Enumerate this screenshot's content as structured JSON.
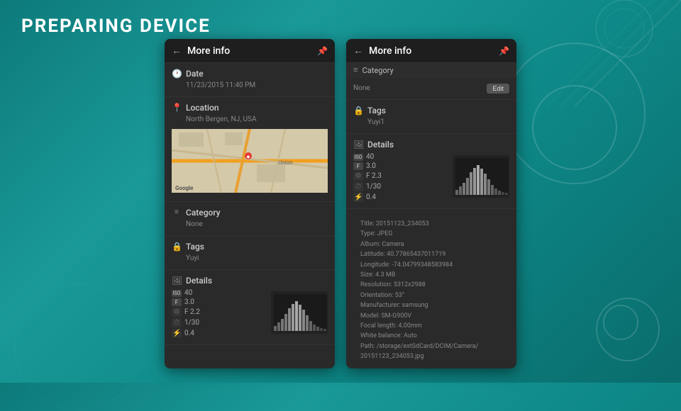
{
  "page": {
    "title": "PREPARING DEVICE",
    "background_color": "#0d8080"
  },
  "left_panel": {
    "header": {
      "back_label": "←",
      "title": "More info",
      "pin_icon": "📌"
    },
    "date_section": {
      "label": "Date",
      "icon": "🕐",
      "value": "11/23/2015 11:40 PM"
    },
    "location_section": {
      "label": "Location",
      "icon": "📍",
      "value": "North Bergen, NJ, USA"
    },
    "category_section": {
      "label": "Category",
      "icon": "≡",
      "value": "None"
    },
    "tags_section": {
      "label": "Tags",
      "icon": "🔒",
      "value": "Yuyi"
    },
    "details_section": {
      "label": "Details",
      "icon": "🖼",
      "rows": [
        {
          "icon": "ISO",
          "value": "40"
        },
        {
          "icon": "F",
          "value": "3.0"
        },
        {
          "icon": "⚙",
          "value": "F 2.2"
        },
        {
          "icon": "⏱",
          "value": "1/30"
        },
        {
          "icon": "⚡",
          "value": "0.4"
        }
      ]
    }
  },
  "right_panel": {
    "header": {
      "back_label": "←",
      "title": "More info",
      "pin_icon": "📌"
    },
    "category_section": {
      "label": "Category",
      "icon": "≡",
      "value": "None",
      "edit_label": "Edit"
    },
    "tags_section": {
      "label": "Tags",
      "icon": "🔒",
      "value": "Yuyi1"
    },
    "details_section": {
      "label": "Details",
      "icon": "🖼",
      "rows": [
        {
          "icon": "ISO",
          "value": "40"
        },
        {
          "icon": "F",
          "value": "3.0"
        },
        {
          "icon": "⚙",
          "value": "F 2.3"
        },
        {
          "icon": "⏱",
          "value": "1/30"
        },
        {
          "icon": "⚡",
          "value": "0.4"
        }
      ]
    },
    "meta": [
      {
        "label": "Title",
        "value": "20151123_234053"
      },
      {
        "label": "Type",
        "value": "JPEG"
      },
      {
        "label": "Album",
        "value": "Camera"
      },
      {
        "label": "Latitude",
        "value": "40.77865437011719"
      },
      {
        "label": "Longitude",
        "value": "-74.04799348583984"
      },
      {
        "label": "Size",
        "value": "4.3 MB"
      },
      {
        "label": "Resolution",
        "value": "5312x2988"
      },
      {
        "label": "Orientation",
        "value": "53°"
      },
      {
        "label": "Manufacturer",
        "value": "samsung"
      },
      {
        "label": "Model",
        "value": "SM-G900V"
      },
      {
        "label": "Focal length",
        "value": "4.00mm"
      },
      {
        "label": "White balance",
        "value": "Auto"
      },
      {
        "label": "Path",
        "value": "/storage/extSdCard/DCIM/Camera/ 20151123_234053.jpg"
      }
    ]
  }
}
